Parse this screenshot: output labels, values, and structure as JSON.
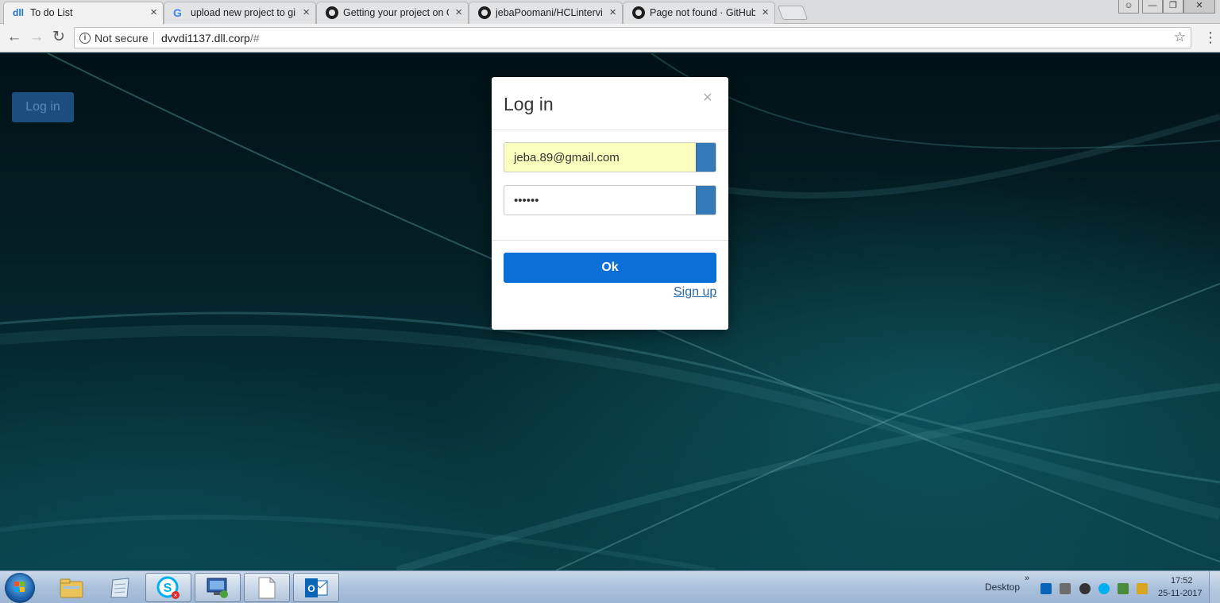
{
  "browser": {
    "tabs": [
      {
        "title": "To do List",
        "icon": "dll-logo-icon",
        "active": true
      },
      {
        "title": "upload new project to gi",
        "icon": "google-icon",
        "active": false
      },
      {
        "title": "Getting your project on G",
        "icon": "github-icon",
        "active": false
      },
      {
        "title": "jebaPoomani/HCLintervie",
        "icon": "github-icon",
        "active": false
      },
      {
        "title": "Page not found · GitHub",
        "icon": "github-icon",
        "active": false
      }
    ],
    "tab_close_glyph": "×",
    "security_label": "Not secure",
    "url_host": "dvvdi1137.dll.corp",
    "url_rest": "/#"
  },
  "page": {
    "login_button": "Log in"
  },
  "modal": {
    "title": "Log in",
    "close_glyph": "×",
    "email_value": "jeba.89@gmail.com",
    "password_value": "••••••",
    "ok_label": "Ok",
    "signup_label": "Sign up",
    "accent_color": "#0a6fd6",
    "addon_color": "#337ab7"
  },
  "taskbar": {
    "apps": [
      "explorer-icon",
      "notepad-icon",
      "skype-icon",
      "remote-desktop-icon",
      "blank-document-icon",
      "outlook-icon"
    ],
    "desktop_label": "Desktop",
    "tray_chevron": "»",
    "time": "17:52",
    "date": "25-11-2017"
  }
}
